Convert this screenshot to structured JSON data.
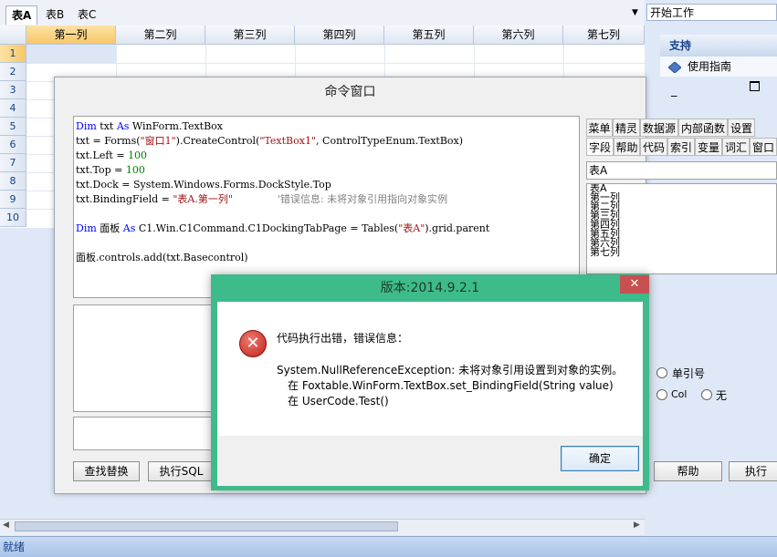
{
  "sheet_tabs": [
    "表A",
    "表B",
    "表C"
  ],
  "start_combo": "开始工作",
  "grid": {
    "columns": [
      "第一列",
      "第二列",
      "第三列",
      "第四列",
      "第五列",
      "第六列",
      "第七列"
    ],
    "rows": [
      "1",
      "2",
      "3",
      "4",
      "5",
      "6",
      "7",
      "8",
      "9",
      "10"
    ]
  },
  "support_panel": {
    "header": "支持",
    "item": "使用指南"
  },
  "command_window": {
    "title": "命令窗口",
    "code_lines": [
      "Dim txt As WinForm.TextBox",
      "txt = Forms(\"窗口1\").CreateControl(\"TextBox1\", ControlTypeEnum.TextBox)",
      "txt.Left = 100",
      "txt.Top = 100",
      "txt.Dock = System.Windows.Forms.DockStyle.Top",
      "txt.BindingField = \"表A.第一列\"              '错误信息: 未将对象引用指向对象实例",
      "",
      "Dim 面板 As C1.Win.C1Command.C1DockingTabPage = Tables(\"表A\").grid.parent",
      "",
      "面板.controls.add(txt.Basecontrol)"
    ],
    "buttons": {
      "find_replace": "查找替换",
      "exec_sql": "执行SQL",
      "help": "帮助",
      "execute": "执行"
    },
    "side_tabs_row1": [
      "菜单",
      "精灵",
      "数据源",
      "内部函数",
      "设置"
    ],
    "side_tabs_row2": [
      "字段",
      "帮助",
      "代码",
      "索引",
      "变量",
      "词汇",
      "窗口"
    ],
    "table_combo": "表A",
    "field_list": [
      "表A",
      "第一列",
      "第二列",
      "第三列",
      "第四列",
      "第五列",
      "第六列",
      "第七列"
    ],
    "radio_single_quote": "单引号",
    "radio_col": "Col",
    "radio_none": "无"
  },
  "dialog": {
    "title": "版本:2014.9.2.1",
    "close": "✕",
    "heading": "代码执行出错，错误信息：",
    "message_line1": "System.NullReferenceException: 未将对象引用设置到对象的实例。",
    "message_line2": "在 Foxtable.WinForm.TextBox.set_BindingField(String value)",
    "message_line3": "在 UserCode.Test()",
    "ok": "确定"
  },
  "status": "就绪"
}
